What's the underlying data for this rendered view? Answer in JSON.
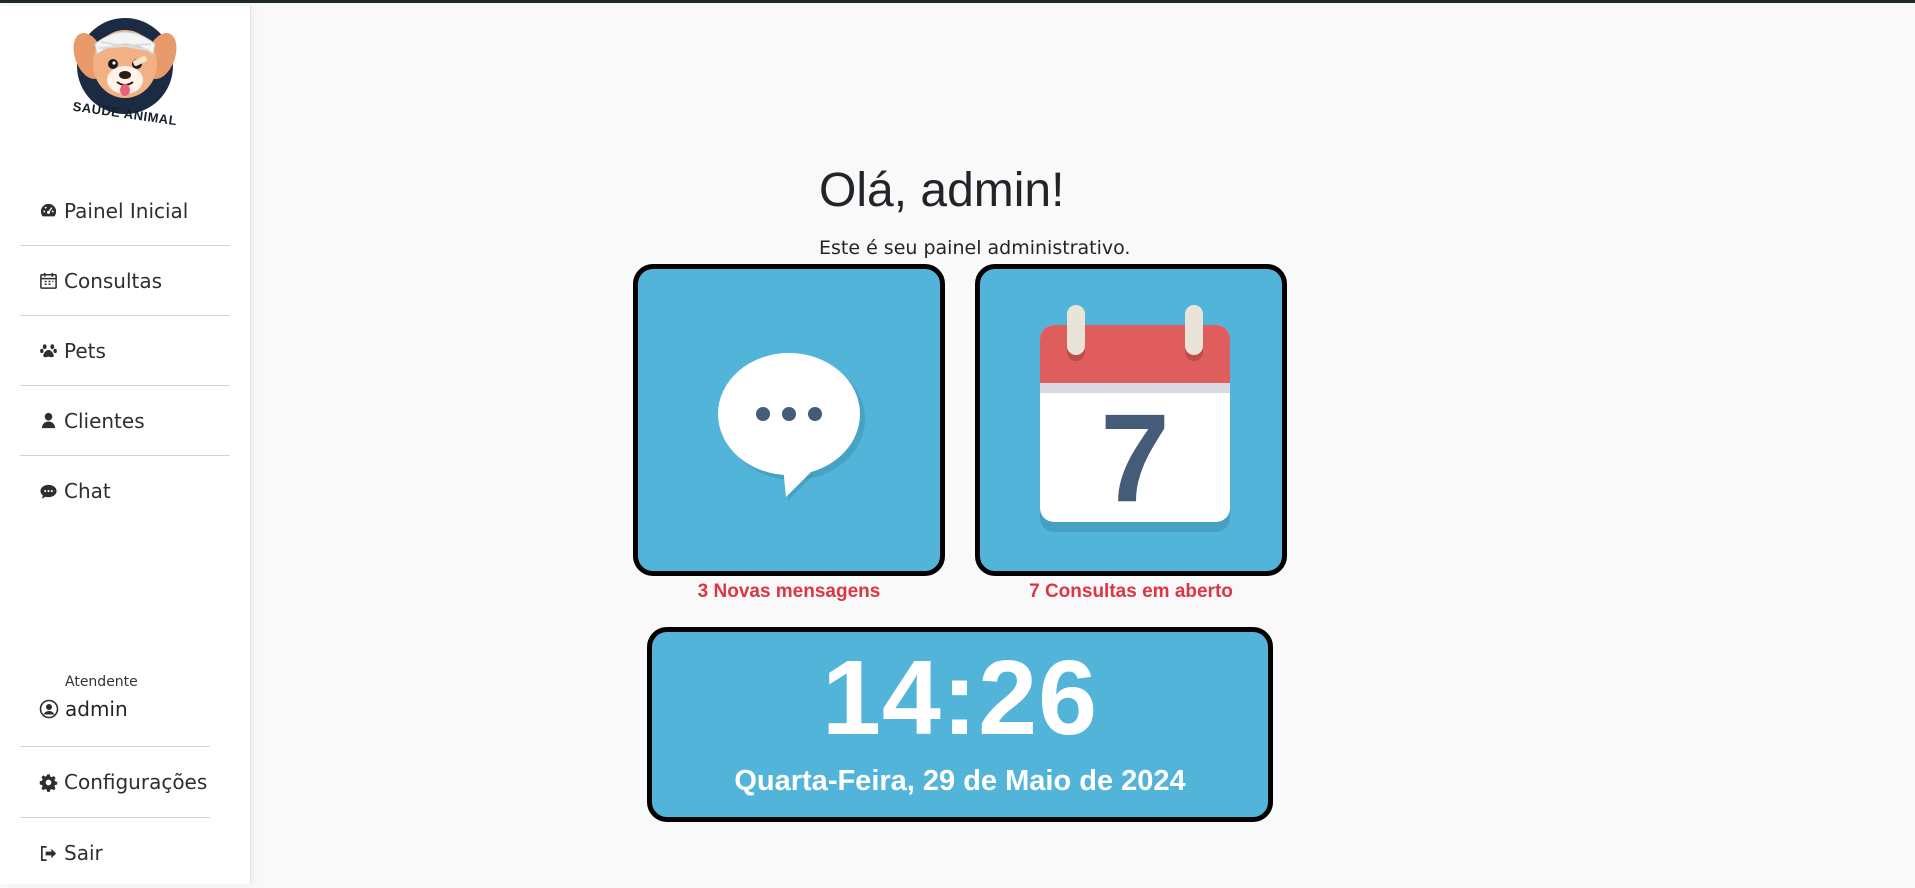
{
  "brand": {
    "logo_text": "SAÚDE ANIMAL"
  },
  "sidebar": {
    "items": [
      {
        "label": "Painel Inicial",
        "icon": "dashboard-icon"
      },
      {
        "label": "Consultas",
        "icon": "calendar-icon"
      },
      {
        "label": "Pets",
        "icon": "paw-icon"
      },
      {
        "label": "Clientes",
        "icon": "user-icon"
      },
      {
        "label": "Chat",
        "icon": "chat-icon"
      }
    ],
    "user": {
      "role": "Atendente",
      "name": "admin",
      "icon": "user-circle-icon"
    },
    "bottom_items": [
      {
        "label": "Configurações",
        "icon": "gear-icon"
      },
      {
        "label": "Sair",
        "icon": "sign-out-icon"
      }
    ]
  },
  "main": {
    "greeting": "Olá, admin!",
    "subtitle": "Este é seu painel administrativo.",
    "cards": [
      {
        "label": "3 Novas mensagens",
        "icon": "speech-bubble-icon"
      },
      {
        "label": "7 Consultas em aberto",
        "icon": "calendar-day-icon",
        "calendar_day": "7"
      }
    ],
    "clock": {
      "time": "14:26",
      "date": "Quarta-Feira, 29 de Maio de 2024"
    }
  },
  "colors": {
    "card_bg": "#52b4d9",
    "alert_text": "#dc3545",
    "calendar_red": "#e05d5d",
    "digit_navy": "#445c78"
  }
}
